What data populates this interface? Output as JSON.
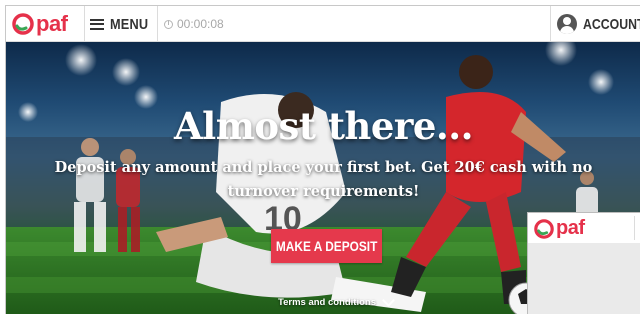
{
  "header": {
    "brand": "paf",
    "menu_label": "MENU",
    "timer": "00:00:08",
    "account_label": "ACCOUNT"
  },
  "hero": {
    "title": "Almost there...",
    "subtitle": "Deposit any amount and place your first bet. Get 20€ cash with no turnover requirements!",
    "cta_label": "MAKE A DEPOSIT",
    "terms_label": "Terms and conditions"
  },
  "popup": {
    "brand": "paf"
  },
  "colors": {
    "brand_red": "#e5314a",
    "cta_red": "#e5394c",
    "text_dark": "#333333"
  },
  "icons": [
    "paf-logo-icon",
    "hamburger-icon",
    "clock-icon",
    "user-icon",
    "chevron-down-icon"
  ]
}
